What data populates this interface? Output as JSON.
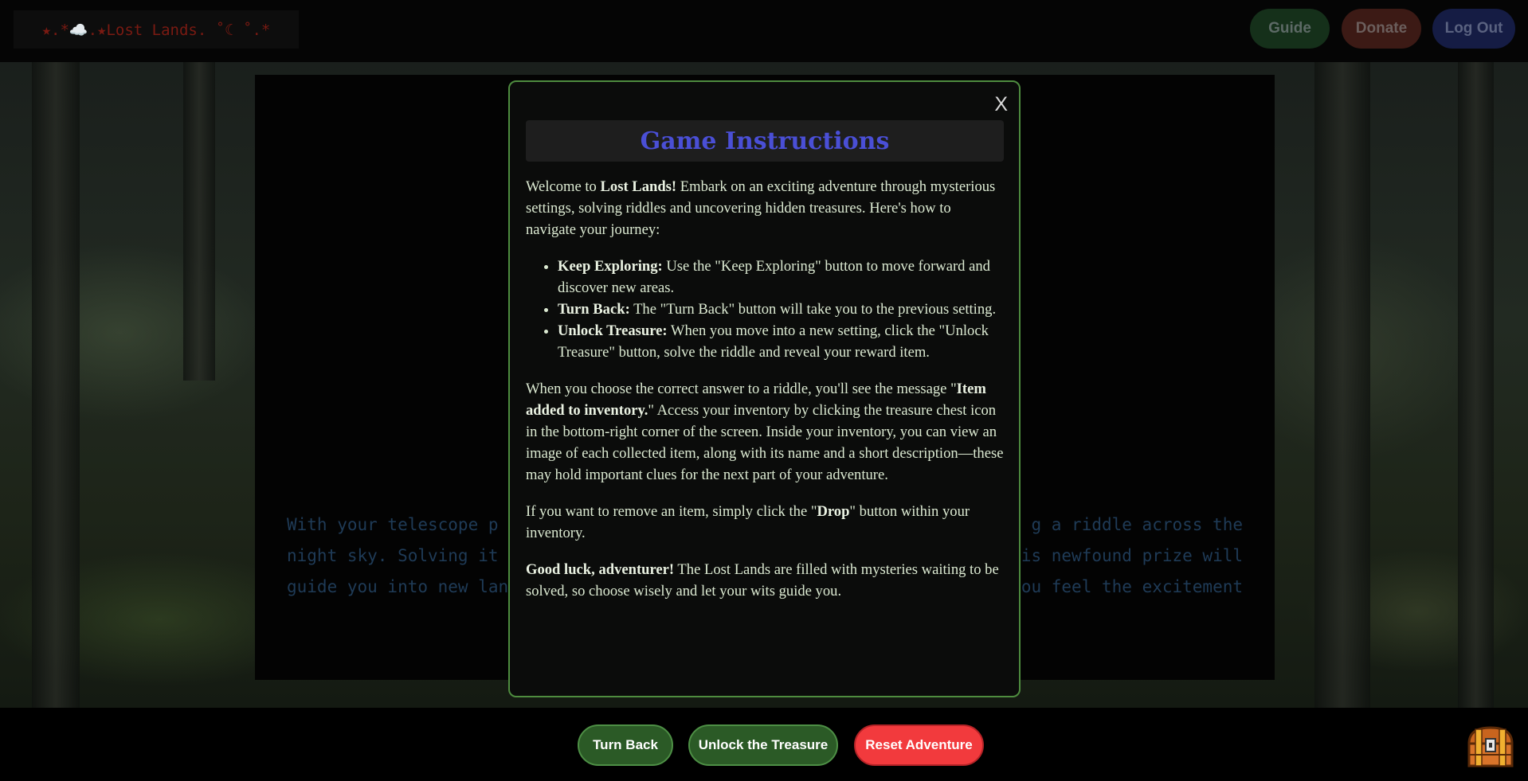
{
  "header": {
    "logo": "★.*☁️.★Lost Lands. ˚☾ ˚.*",
    "nav": {
      "guide": "Guide",
      "donate": "Donate",
      "logout": "Log Out"
    }
  },
  "colors": {
    "accent_green": "#2b5a26",
    "reset_red": "#f23a3d",
    "title_blue": "#4a4fd6",
    "modal_border": "#4e8c3f"
  },
  "story": {
    "line1_left": "With your telescope p",
    "line1_right": "g a riddle across the",
    "line2_left": "night sky. Solving it pr",
    "line2_right": "his newfound prize will",
    "line3_left": "guide you into new lands",
    "line3_right": "you feel the excitement"
  },
  "modal": {
    "close": "X",
    "title": "Game Instructions",
    "intro_pre": "Welcome to ",
    "intro_bold": "Lost Lands!",
    "intro_post": " Embark on an exciting adventure through mysterious settings, solving riddles and uncovering hidden treasures. Here's how to navigate your journey:",
    "items": [
      {
        "label": "Keep Exploring:",
        "text": " Use the \"Keep Exploring\" button to move forward and discover new areas."
      },
      {
        "label": "Turn Back:",
        "text": " The \"Turn Back\" button will take you to the previous setting."
      },
      {
        "label": "Unlock Treasure:",
        "text": " When you move into a new setting, click the \"Unlock Treasure\" button, solve the riddle and reveal your reward item."
      }
    ],
    "para2_pre": "When you choose the correct answer to a riddle, you'll see the message \"",
    "para2_bold": "Item added to inventory.",
    "para2_post": "\" Access your inventory by clicking the treasure chest icon in the bottom-right corner of the screen. Inside your inventory, you can view an image of each collected item, along with its name and a short description—these may hold important clues for the next part of your adventure.",
    "para3_pre": "If you want to remove an item, simply click the \"",
    "para3_bold": "Drop",
    "para3_post": "\" button within your inventory.",
    "para4_bold": "Good luck, adventurer!",
    "para4_post": " The Lost Lands are filled with mysteries waiting to be solved, so choose wisely and let your wits guide you."
  },
  "footer": {
    "turn_back": "Turn Back",
    "unlock": "Unlock the Treasure",
    "reset": "Reset Adventure",
    "inventory_icon": "treasure-chest-icon"
  }
}
